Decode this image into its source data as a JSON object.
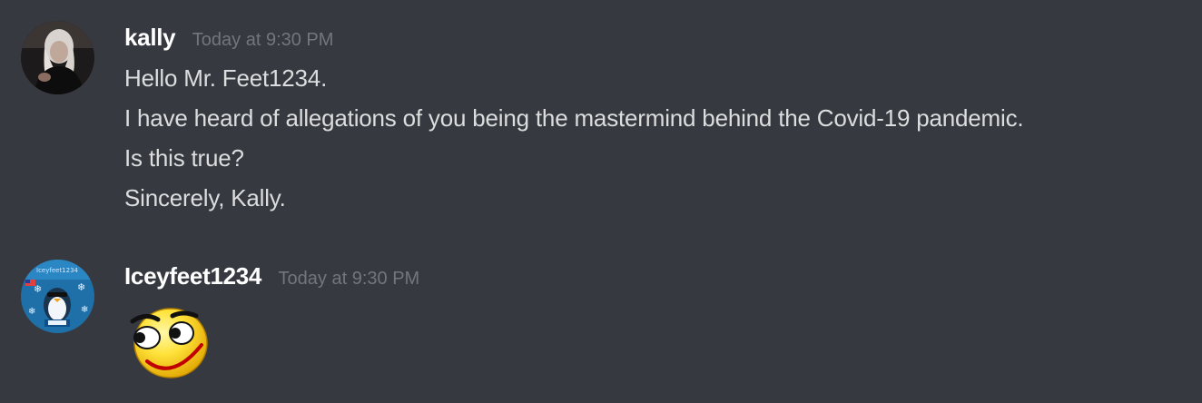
{
  "messages": [
    {
      "author": "kally",
      "timestamp": "Today at 9:30 PM",
      "lines": [
        "Hello Mr. Feet1234.",
        "I have heard of allegations of you being the mastermind behind the Covid-19 pandemic.",
        "Is this true?",
        "Sincerely, Kally."
      ]
    },
    {
      "author": "Iceyfeet1234",
      "timestamp": "Today at 9:30 PM",
      "emoji": "smirking-face-emoji"
    }
  ],
  "colors": {
    "background": "#36393f",
    "username": "#ffffff",
    "text": "#dcddde",
    "timestamp": "#72767d"
  }
}
